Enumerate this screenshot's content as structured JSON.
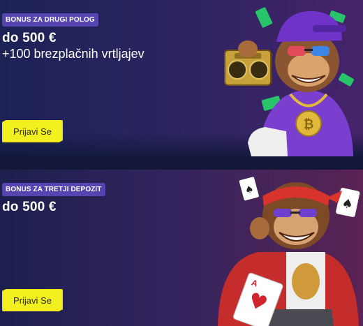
{
  "cards": [
    {
      "badge": "BONUS ZA DRUGI POLOG",
      "amount": "do 500 €",
      "subtitle": "+100 brezplačnih vrtljajev",
      "button": "Prijavi Se",
      "illustration": "monkey-with-boombox-icon",
      "accent": "#7b3fd0"
    },
    {
      "badge": "BONUS ZA TRETJI DEPOZIT",
      "amount": "do 500 €",
      "button": "Prijavi Se",
      "illustration": "monkey-with-playing-cards-icon",
      "accent": "#c52d2d"
    }
  ],
  "colors": {
    "badge_bg": "#5645b0",
    "button_bg": "#f3f01f",
    "page_bg": "#151a3d"
  }
}
